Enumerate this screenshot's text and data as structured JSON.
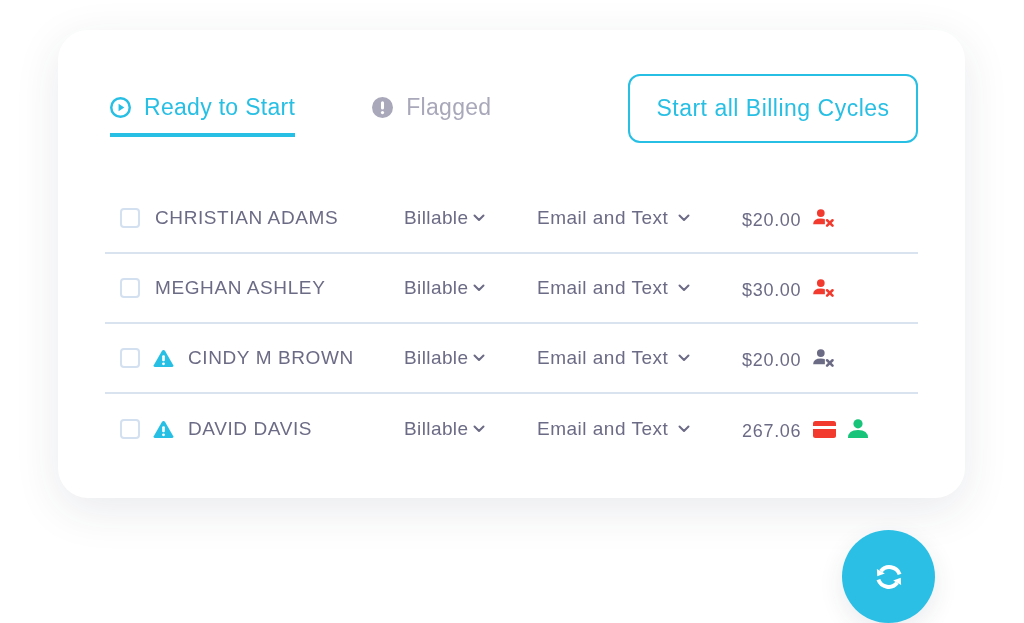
{
  "tabs": [
    {
      "label": "Ready to Start",
      "selected": true
    },
    {
      "label": "Flagged",
      "selected": false
    }
  ],
  "start_button": {
    "label": "Start all Billing Cycles"
  },
  "rows": [
    {
      "checked": false,
      "flagged": false,
      "name": "CHRISTIAN ADAMS",
      "billing": "Billable",
      "notification": "Email and Text",
      "amount": "$20.00",
      "status_icons": [
        {
          "kind": "user-x",
          "color": "#f23b2e"
        }
      ]
    },
    {
      "checked": false,
      "flagged": false,
      "name": "MEGHAN ASHLEY",
      "billing": "Billable",
      "notification": "Email and Text",
      "amount": "$30.00",
      "status_icons": [
        {
          "kind": "user-x",
          "color": "#f23b2e"
        }
      ]
    },
    {
      "checked": false,
      "flagged": true,
      "name": "CINDY M BROWN",
      "billing": "Billable",
      "notification": "Email and Text",
      "amount": "$20.00",
      "status_icons": [
        {
          "kind": "user-x",
          "color": "#6c6b86"
        }
      ]
    },
    {
      "checked": false,
      "flagged": true,
      "name": "DAVID DAVIS",
      "billing": "Billable",
      "notification": "Email and Text",
      "amount": "267.06",
      "status_icons": [
        {
          "kind": "card",
          "color": "#f23b2e"
        },
        {
          "kind": "user",
          "color": "#17c479"
        }
      ]
    }
  ]
}
